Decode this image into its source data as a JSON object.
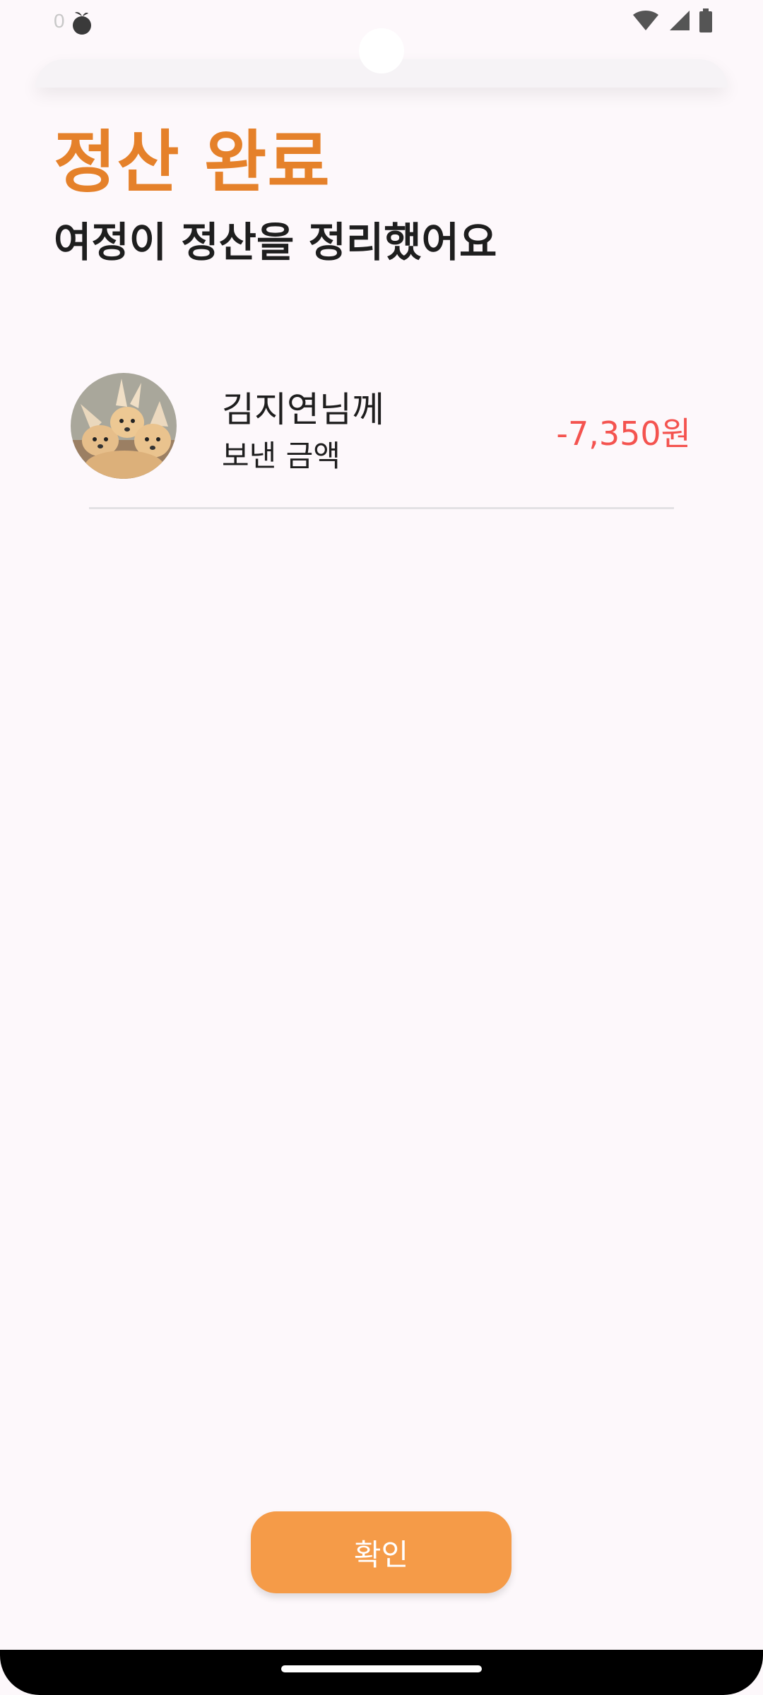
{
  "status_bar": {
    "time": "0",
    "icons": [
      "notification-fruit-icon",
      "wifi-icon",
      "cellular-signal-icon",
      "battery-icon"
    ]
  },
  "header": {
    "title": "정산 완료",
    "subtitle": "여정이 정산을 정리했어요"
  },
  "transfer": {
    "recipient": "김지연님께",
    "description": "보낸 금액",
    "amount": "-7,350원",
    "avatar": "fennec-fox-avatar"
  },
  "footer": {
    "confirm_label": "확인"
  },
  "colors": {
    "accent": "#e5812a",
    "button": "#f59b48",
    "negative_amount": "#f4534f",
    "background": "#fdf8fb"
  }
}
